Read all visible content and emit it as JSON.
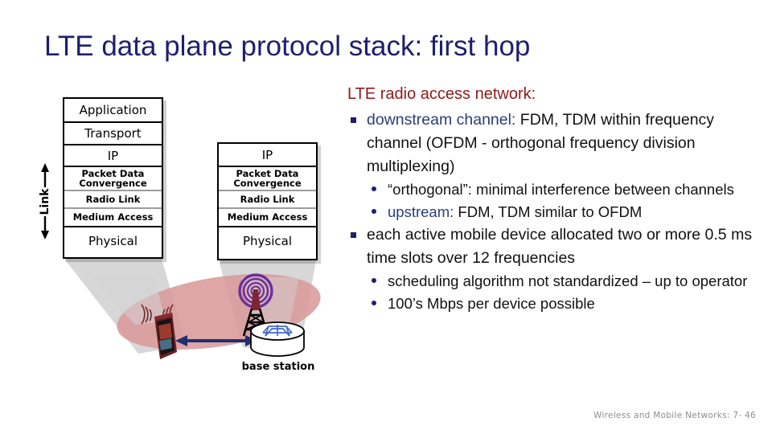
{
  "slide": {
    "title": "LTE data plane protocol stack: first hop",
    "footer": "Wireless and Mobile Networks: 7- 46",
    "colors": {
      "title": "#1f1f6e",
      "heading_red": "#8e1b1b",
      "highlight_blue": "#2b3d7a",
      "bullet_navy": "#1f1f6e",
      "cell_ellipse_pink": "#d99a9a",
      "cone_gray": "#d5d5d5",
      "tower_purple": "#6b2f9e",
      "arrow_navy": "#1f2f70",
      "footer_gray": "#8d8d8d"
    }
  },
  "diagram": {
    "mobile_stack": {
      "name": "mobile device protocol stack",
      "layers": [
        {
          "label": "Application",
          "size": "big"
        },
        {
          "label": "Transport",
          "size": "big"
        },
        {
          "label": "IP",
          "size": "big"
        },
        {
          "label": "Packet Data Convergence",
          "size": "small"
        },
        {
          "label": "Radio Link",
          "size": "small"
        },
        {
          "label": "Medium Access",
          "size": "small"
        },
        {
          "label": "Physical",
          "size": "big"
        }
      ]
    },
    "base_station_stack": {
      "name": "base station protocol stack",
      "layers": [
        {
          "label": "IP",
          "size": "big"
        },
        {
          "label": "Packet Data Convergence",
          "size": "small"
        },
        {
          "label": "Radio Link",
          "size": "small"
        },
        {
          "label": "Medium Access",
          "size": "small"
        },
        {
          "label": "Physical",
          "size": "big"
        }
      ]
    },
    "link_bracket_label": "Link",
    "base_station_caption": "base station"
  },
  "notes": {
    "heading": "LTE radio access network:",
    "bullets": [
      {
        "level": 1,
        "prefix": "downstream channel:",
        "text": " FDM, TDM within frequency channel (OFDM - orthogonal frequency division multiplexing)"
      },
      {
        "level": 2,
        "prefix": "",
        "text": "“orthogonal”: minimal interference between channels"
      },
      {
        "level": 2,
        "prefix": "upstream:",
        "text": " FDM, TDM similar to OFDM"
      },
      {
        "level": 1,
        "prefix": "",
        "text": "each active mobile device allocated two or more 0.5 ms time slots over 12 frequencies"
      },
      {
        "level": 2,
        "prefix": "",
        "text": "scheduling algorithm not standardized – up to operator"
      },
      {
        "level": 2,
        "prefix": "",
        "text": "100’s Mbps per device possible"
      }
    ]
  }
}
